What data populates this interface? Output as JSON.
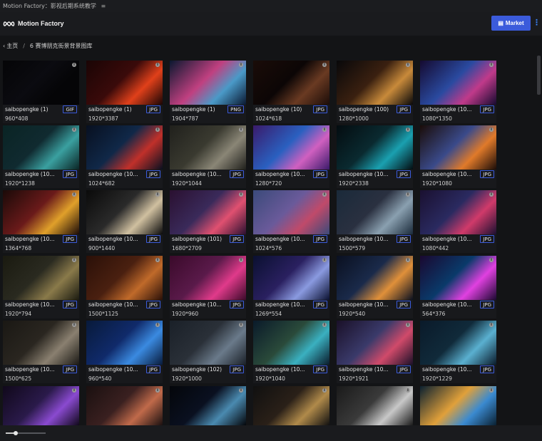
{
  "window": {
    "title": "Motion Factory：影视后期系统教学",
    "menu_icon": "hamburger-icon"
  },
  "header": {
    "logo_icon": "meta-infinity-icon",
    "brand": "Motion Factory",
    "market_label": "Market",
    "market_icon": "shop-icon",
    "more_icon": "vertical-dots-icon"
  },
  "breadcrumb": {
    "home": "主页",
    "separator": "/",
    "current": "6 赛博朋克街景背景图库"
  },
  "colors": {
    "accent": "#3b5bdb",
    "background": "#131416"
  },
  "zoom": {
    "level": 0.25
  },
  "items": [
    {
      "name": "saibopengke (1)",
      "type": "GIF",
      "dims": "960*408",
      "thumb": [
        "#050507",
        "#050507",
        "#0b0b10"
      ]
    },
    {
      "name": "saibopengke (1)",
      "type": "JPG",
      "dims": "1920*3387",
      "thumb": [
        "#1a0505",
        "#e0401a",
        "#3a0a0a"
      ]
    },
    {
      "name": "saibopengke (1)",
      "type": "PNG",
      "dims": "1904*787",
      "thumb": [
        "#0a1830",
        "#4a9ac8",
        "#c04080"
      ]
    },
    {
      "name": "saibopengke (10)",
      "type": "JPG",
      "dims": "1024*618",
      "thumb": [
        "#1a0c08",
        "#6a3a22",
        "#0c0606"
      ]
    },
    {
      "name": "saibopengke (100)",
      "type": "JPG",
      "dims": "1280*1000",
      "thumb": [
        "#08080a",
        "#c88a3a",
        "#3a2010"
      ]
    },
    {
      "name": "saibopengke (10...",
      "type": "JPG",
      "dims": "1080*1350",
      "thumb": [
        "#150a30",
        "#c03a8a",
        "#2a4aa0"
      ]
    },
    {
      "name": "saibopengke (10...",
      "type": "JPG",
      "dims": "1920*1238",
      "thumb": [
        "#0a2424",
        "#3aa0a0",
        "#102a30"
      ]
    },
    {
      "name": "saibopengke (10...",
      "type": "JPG",
      "dims": "1024*682",
      "thumb": [
        "#081020",
        "#c0302a",
        "#102848"
      ]
    },
    {
      "name": "saibopengke (10...",
      "type": "JPG",
      "dims": "1920*1044",
      "thumb": [
        "#20201c",
        "#8a8676",
        "#3a3a30"
      ]
    },
    {
      "name": "saibopengke (10...",
      "type": "JPG",
      "dims": "1280*720",
      "thumb": [
        "#3a1a6a",
        "#d060c0",
        "#2a60c0"
      ]
    },
    {
      "name": "saibopengke (10...",
      "type": "JPG",
      "dims": "1920*2338",
      "thumb": [
        "#040c10",
        "#1aa0b0",
        "#0a2a30"
      ]
    },
    {
      "name": "saibopengke (10...",
      "type": "JPG",
      "dims": "1920*1080",
      "thumb": [
        "#1a0c08",
        "#e07a2a",
        "#3a4a8a"
      ]
    },
    {
      "name": "saibopengke (10...",
      "type": "JPG",
      "dims": "1364*768",
      "thumb": [
        "#1a0a08",
        "#e0a02a",
        "#6a1a1a"
      ]
    },
    {
      "name": "saibopengke (10...",
      "type": "JPG",
      "dims": "900*1440",
      "thumb": [
        "#0a0a0a",
        "#d0c0a0",
        "#2a2a2a"
      ]
    },
    {
      "name": "saibopengke (101)",
      "type": "JPG",
      "dims": "1680*2709",
      "thumb": [
        "#2a1030",
        "#e05070",
        "#3a2a5a"
      ]
    },
    {
      "name": "saibopengke (10...",
      "type": "JPG",
      "dims": "1024*576",
      "thumb": [
        "#3a4a7a",
        "#c04a6a",
        "#6a5a9a"
      ]
    },
    {
      "name": "saibopengke (10...",
      "type": "JPG",
      "dims": "1500*579",
      "thumb": [
        "#1a2a3a",
        "#8aa0b0",
        "#2a3040"
      ]
    },
    {
      "name": "saibopengke (10...",
      "type": "JPG",
      "dims": "1080*442",
      "thumb": [
        "#1a1030",
        "#d03a6a",
        "#2a2a60"
      ]
    },
    {
      "name": "saibopengke (10...",
      "type": "JPG",
      "dims": "1920*794",
      "thumb": [
        "#1a1a10",
        "#8a7a4a",
        "#2a2a20"
      ]
    },
    {
      "name": "saibopengke (10...",
      "type": "JPG",
      "dims": "1500*1125",
      "thumb": [
        "#2a1008",
        "#c06a2a",
        "#4a2010"
      ]
    },
    {
      "name": "saibopengke (10...",
      "type": "JPG",
      "dims": "1920*960",
      "thumb": [
        "#3a0a2a",
        "#e03a8a",
        "#5a1a4a"
      ]
    },
    {
      "name": "saibopengke (10...",
      "type": "JPG",
      "dims": "1269*554",
      "thumb": [
        "#0a1030",
        "#8a9ae0",
        "#2a2060"
      ]
    },
    {
      "name": "saibopengke (10...",
      "type": "JPG",
      "dims": "1920*540",
      "thumb": [
        "#0a1020",
        "#e0903a",
        "#1a2a4a"
      ]
    },
    {
      "name": "saibopengke (10...",
      "type": "JPG",
      "dims": "564*376",
      "thumb": [
        "#1a0830",
        "#e040e0",
        "#0a3a6a"
      ]
    },
    {
      "name": "saibopengke (10...",
      "type": "JPG",
      "dims": "1500*625",
      "thumb": [
        "#1a1814",
        "#8a8070",
        "#2a2620"
      ]
    },
    {
      "name": "saibopengke (10...",
      "type": "JPG",
      "dims": "960*540",
      "thumb": [
        "#081a3a",
        "#3a8ae0",
        "#102a6a"
      ]
    },
    {
      "name": "saibopengke (102)",
      "type": "JPG",
      "dims": "1920*1000",
      "thumb": [
        "#1a2028",
        "#6a7a8a",
        "#2a3038"
      ]
    },
    {
      "name": "saibopengke (10...",
      "type": "JPG",
      "dims": "1920*1040",
      "thumb": [
        "#0a1a2a",
        "#3ab0c0",
        "#2a4a3a"
      ]
    },
    {
      "name": "saibopengke (10...",
      "type": "JPG",
      "dims": "1920*1921",
      "thumb": [
        "#1a1028",
        "#d04a6a",
        "#3a3a6a"
      ]
    },
    {
      "name": "saibopengke (10...",
      "type": "JPG",
      "dims": "1920*1229",
      "thumb": [
        "#0a1a2a",
        "#5ab0d0",
        "#102a3a"
      ]
    },
    {
      "name": "",
      "type": "",
      "dims": "",
      "thumb": [
        "#10081a",
        "#8a4ad0",
        "#2a1a4a"
      ]
    },
    {
      "name": "",
      "type": "",
      "dims": "",
      "thumb": [
        "#1a1010",
        "#c06a4a",
        "#3a2020"
      ]
    },
    {
      "name": "",
      "type": "",
      "dims": "",
      "thumb": [
        "#04060a",
        "#4a8ab0",
        "#0a1020"
      ]
    },
    {
      "name": "",
      "type": "",
      "dims": "",
      "thumb": [
        "#101010",
        "#b08a4a",
        "#2a2018"
      ]
    },
    {
      "name": "",
      "type": "",
      "dims": "",
      "thumb": [
        "#1a1a1a",
        "#c8c8c8",
        "#3a3a3a"
      ]
    },
    {
      "name": "",
      "type": "",
      "dims": "",
      "thumb": [
        "#0a2030",
        "#3a8ad0",
        "#e0a03a"
      ]
    }
  ]
}
